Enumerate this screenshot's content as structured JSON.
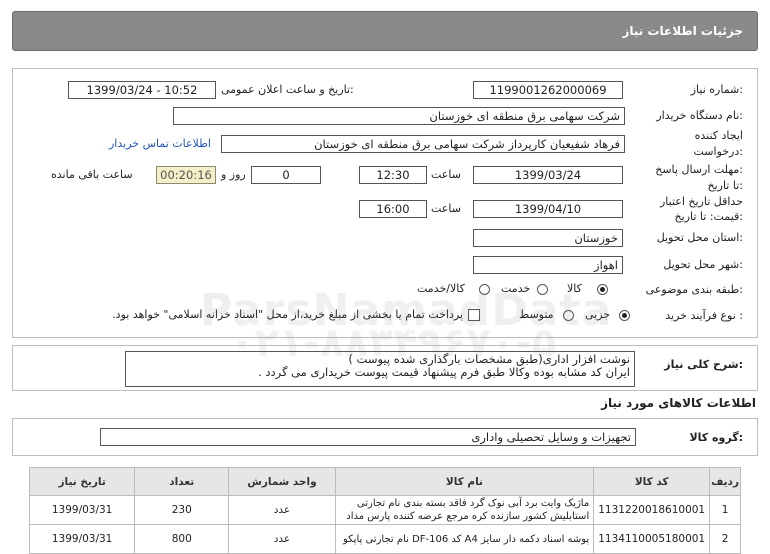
{
  "header": {
    "title": "جزئیات اطلاعات نیاز"
  },
  "form": {
    "need_number_label": "شماره نیاز:",
    "need_number": "1199001262000069",
    "announce_label": "تاریخ و ساعت اعلان عمومی:",
    "announce_value": "1399/03/24 - 10:52",
    "buyer_org_label": "نام دستگاه خریدار:",
    "buyer_org": "شرکت سهامی برق منطقه ای خوزستان",
    "creator_label_1": "ایجاد کننده",
    "creator_label_2": "درخواست:",
    "creator": "فرهاد شفیعیان کارپرداز شرکت سهامی برق منطقه ای خوزستان",
    "contact_link": "اطلاعات تماس خریدار",
    "reply_deadline_label_1": "مهلت ارسال پاسخ:",
    "reply_deadline_label_2": "تا تاریخ:",
    "reply_date": "1399/03/24",
    "time_label": "ساعت",
    "reply_time": "12:30",
    "days_value": "0",
    "days_label": "روز و",
    "remaining_time": "00:20:16",
    "remaining_label": "ساعت باقی مانده",
    "validity_label_1": "حداقل تاریخ اعتبار",
    "validity_label_2": "قیمت: تا تاریخ:",
    "validity_date": "1399/04/10",
    "validity_time_label": "ساعت",
    "validity_time": "16:00",
    "province_label": "استان محل تحویل:",
    "province": "خوزستان",
    "city_label": "شهر محل تحویل:",
    "city": "اهواز",
    "category_label": "طبقه بندی موضوعی:",
    "category_options": [
      "کالا",
      "خدمت",
      "کالا/خدمت"
    ],
    "process_label": "نوع فرآیند خرید :",
    "process_options": [
      "جزیی",
      "متوسط"
    ],
    "payment_note": "پرداخت تمام یا بخشی از مبلغ خرید،از محل \"اسناد خزانه اسلامی\" خواهد بود."
  },
  "description": {
    "label": "شرح کلی نیاز:",
    "line1": "نوشت افزار اداری(طبق مشخصات بارگذاری شده پیوست )",
    "line2": "ایران کد مشابه بوده وکالا طبق فرم پیشنهاد قیمت پیوست خریداری می گردد ."
  },
  "goods_section": {
    "title": "اطلاعات کالاهای مورد نیاز"
  },
  "goods_group": {
    "label": "گروه کالا:",
    "value": "تجهیزات و وسایل تحصیلی واداری"
  },
  "watermark": {
    "line1": "ParsNamadData",
    "line2": "۰۲۱-۸۸۳۴۹۶۷۰-۵"
  },
  "table": {
    "headers": {
      "row": "ردیف",
      "code": "کد کالا",
      "name": "نام کالا",
      "unit": "واحد شمارش",
      "qty": "تعداد",
      "date": "تاریخ نیاز"
    },
    "rows": [
      {
        "row": "1",
        "code": "1131220018610001",
        "name_1": "ماژیک وایت برد آبی نوک گرد فاقد بسته بندی نام تجارتی",
        "name_2": "استابلیش کشور سازنده کره مرجع عرضه کننده پارس مداد",
        "unit": "عدد",
        "qty": "230",
        "date": "1399/03/31"
      },
      {
        "row": "2",
        "code": "1134110005180001",
        "name_1": "پوشه اسناد دکمه دار سایز A4 کد DF-106 نام تجارتی پاپکو",
        "name_2": "",
        "unit": "عدد",
        "qty": "800",
        "date": "1399/03/31"
      }
    ]
  }
}
